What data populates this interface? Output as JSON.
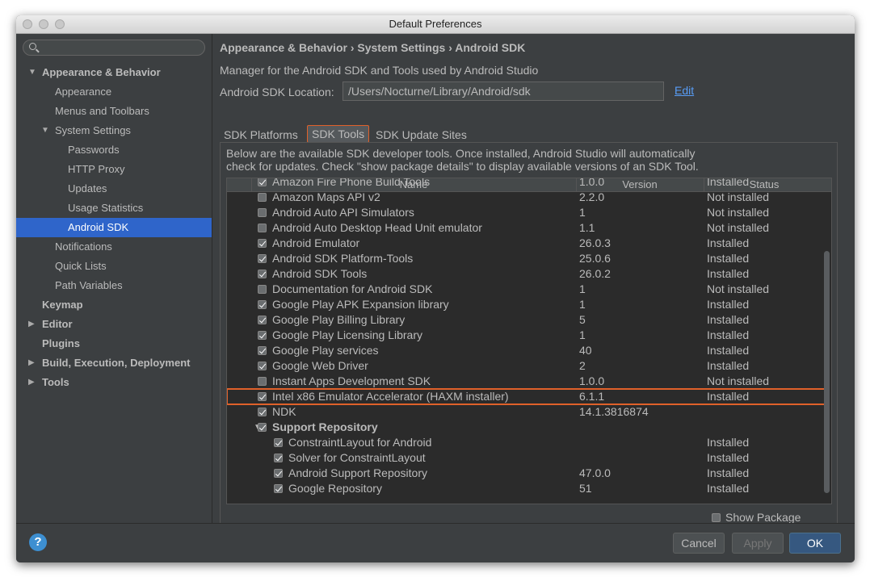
{
  "window": {
    "title": "Default Preferences"
  },
  "sidebar": {
    "items": [
      {
        "label": "Appearance & Behavior",
        "level": 0,
        "arrow": "▼",
        "bold": true
      },
      {
        "label": "Appearance",
        "level": 1
      },
      {
        "label": "Menus and Toolbars",
        "level": 1
      },
      {
        "label": "System Settings",
        "level": 1,
        "arrow": "▼"
      },
      {
        "label": "Passwords",
        "level": 2
      },
      {
        "label": "HTTP Proxy",
        "level": 2
      },
      {
        "label": "Updates",
        "level": 2
      },
      {
        "label": "Usage Statistics",
        "level": 2
      },
      {
        "label": "Android SDK",
        "level": 2,
        "selected": true
      },
      {
        "label": "Notifications",
        "level": 1
      },
      {
        "label": "Quick Lists",
        "level": 1
      },
      {
        "label": "Path Variables",
        "level": 1
      },
      {
        "label": "Keymap",
        "level": 0,
        "bold": true
      },
      {
        "label": "Editor",
        "level": 0,
        "arrow": "▶",
        "bold": true
      },
      {
        "label": "Plugins",
        "level": 0,
        "bold": true
      },
      {
        "label": "Build, Execution, Deployment",
        "level": 0,
        "arrow": "▶",
        "bold": true
      },
      {
        "label": "Tools",
        "level": 0,
        "arrow": "▶",
        "bold": true
      }
    ]
  },
  "main": {
    "breadcrumb": "Appearance & Behavior › System Settings › Android SDK",
    "description": "Manager for the Android SDK and Tools used by Android Studio",
    "location_label": "Android SDK Location:",
    "location_value": "/Users/Nocturne/Library/Android/sdk",
    "edit_label": "Edit",
    "tabs": [
      {
        "label": "SDK Platforms"
      },
      {
        "label": "SDK Tools",
        "active": true
      },
      {
        "label": "SDK Update Sites"
      }
    ],
    "panel_desc_1": "Below are the available SDK developer tools. Once installed, Android Studio will automatically",
    "panel_desc_2": "check for updates. Check \"show package details\" to display available versions of an SDK Tool.",
    "columns": [
      "Name",
      "Version",
      "Status"
    ],
    "rows": [
      {
        "name": "Amazon Fire Phone Build Tools",
        "version": "1.0.0",
        "status": "Installed",
        "checked": true,
        "partial": true
      },
      {
        "name": "Amazon Maps API v2",
        "version": "2.2.0",
        "status": "Not installed",
        "checked": false
      },
      {
        "name": "Android Auto API Simulators",
        "version": "1",
        "status": "Not installed",
        "checked": false
      },
      {
        "name": "Android Auto Desktop Head Unit emulator",
        "version": "1.1",
        "status": "Not installed",
        "checked": false
      },
      {
        "name": "Android Emulator",
        "version": "26.0.3",
        "status": "Installed",
        "checked": true
      },
      {
        "name": "Android SDK Platform-Tools",
        "version": "25.0.6",
        "status": "Installed",
        "checked": true
      },
      {
        "name": "Android SDK Tools",
        "version": "26.0.2",
        "status": "Installed",
        "checked": true
      },
      {
        "name": "Documentation for Android SDK",
        "version": "1",
        "status": "Not installed",
        "checked": false
      },
      {
        "name": "Google Play APK Expansion library",
        "version": "1",
        "status": "Installed",
        "checked": true
      },
      {
        "name": "Google Play Billing Library",
        "version": "5",
        "status": "Installed",
        "checked": true
      },
      {
        "name": "Google Play Licensing Library",
        "version": "1",
        "status": "Installed",
        "checked": true
      },
      {
        "name": "Google Play services",
        "version": "40",
        "status": "Installed",
        "checked": true
      },
      {
        "name": "Google Web Driver",
        "version": "2",
        "status": "Installed",
        "checked": true
      },
      {
        "name": "Instant Apps Development SDK",
        "version": "1.0.0",
        "status": "Not installed",
        "checked": false
      },
      {
        "name": "Intel x86 Emulator Accelerator (HAXM installer)",
        "version": "6.1.1",
        "status": "Installed",
        "checked": true,
        "highlight": true
      },
      {
        "name": "NDK",
        "version": "14.1.3816874",
        "status": "",
        "checked": true
      },
      {
        "name": "Support Repository",
        "version": "",
        "status": "",
        "checked": true,
        "group": true,
        "bold": true
      },
      {
        "name": "ConstraintLayout for Android",
        "version": "",
        "status": "Installed",
        "checked": true,
        "child": true
      },
      {
        "name": "Solver for ConstraintLayout",
        "version": "",
        "status": "Installed",
        "checked": true,
        "child": true
      },
      {
        "name": "Android Support Repository",
        "version": "47.0.0",
        "status": "Installed",
        "checked": true,
        "child": true
      },
      {
        "name": "Google Repository",
        "version": "51",
        "status": "Installed",
        "checked": true,
        "child": true
      }
    ],
    "show_package_details": "Show Package Details"
  },
  "footer": {
    "help_label": "?",
    "cancel_label": "Cancel",
    "apply_label": "Apply",
    "ok_label": "OK"
  }
}
